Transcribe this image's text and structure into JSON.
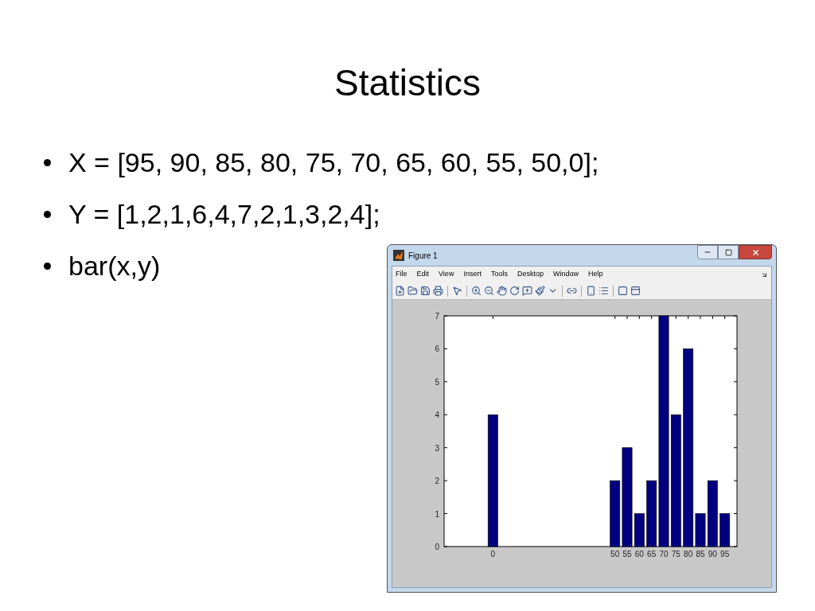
{
  "slide": {
    "title": "Statistics",
    "bullets": [
      "X = [95, 90, 85, 80, 75, 70, 65, 60, 55, 50,0];",
      "Y = [1,2,1,6,4,7,2,1,3,2,4];",
      "bar(x,y)"
    ]
  },
  "window": {
    "title": "Figure 1",
    "menu": [
      "File",
      "Edit",
      "View",
      "Insert",
      "Tools",
      "Desktop",
      "Window",
      "Help"
    ],
    "chart_data": {
      "type": "bar",
      "x": [
        0,
        50,
        55,
        60,
        65,
        70,
        75,
        80,
        85,
        90,
        95
      ],
      "values": [
        4,
        2,
        3,
        1,
        2,
        7,
        4,
        6,
        1,
        2,
        1
      ],
      "xlim": [
        -20,
        100
      ],
      "ylim": [
        0,
        7
      ],
      "xticks": [
        0,
        50,
        55,
        60,
        65,
        70,
        75,
        80,
        85,
        90,
        95
      ],
      "yticks": [
        0,
        1,
        2,
        3,
        4,
        5,
        6,
        7
      ]
    }
  }
}
